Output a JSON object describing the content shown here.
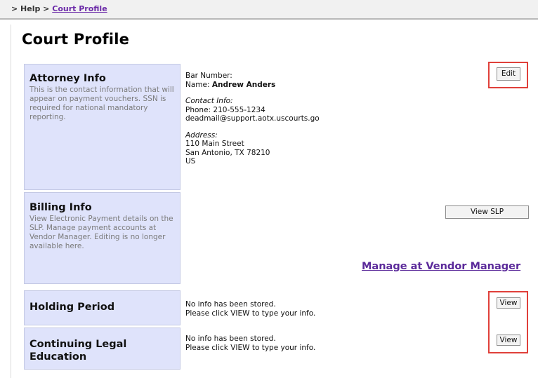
{
  "breadcrumb": {
    "prefix": "> Help >",
    "current": "Court Profile"
  },
  "page_title": "Court Profile",
  "attorney": {
    "heading": "Attorney Info",
    "description": "This is the contact information that will appear on payment vouchers. SSN is required for national mandatory reporting.",
    "bar_number_label": "Bar Number:",
    "name_label": "Name:",
    "name_value": "Andrew Anders",
    "contact_label": "Contact Info:",
    "phone": "Phone: 210-555-1234",
    "email": "deadmail@support.aotx.uscourts.go",
    "address_label": "Address:",
    "address_line1": "110 Main Street",
    "address_line2": "San Antonio, TX 78210",
    "address_line3": "US",
    "edit_label": "Edit"
  },
  "billing": {
    "heading": "Billing Info",
    "description": "View Electronic Payment details on the SLP. Manage payment accounts at Vendor Manager. Editing is no longer available here.",
    "view_slp_label": "View SLP",
    "vendor_link": "Manage at Vendor Manager"
  },
  "holding": {
    "heading": "Holding Period",
    "line1": "No info has been stored.",
    "line2": "Please click VIEW to type your info.",
    "view_label": "View"
  },
  "cle": {
    "heading_line1": "Continuing Legal",
    "heading_line2": "Education",
    "line1": "No info has been stored.",
    "line2": "Please click VIEW to type your info.",
    "view_label": "View"
  },
  "colors": {
    "panel_bg": "#dfe3fb",
    "highlight": "#e0403a",
    "link": "#5b2a9a"
  }
}
